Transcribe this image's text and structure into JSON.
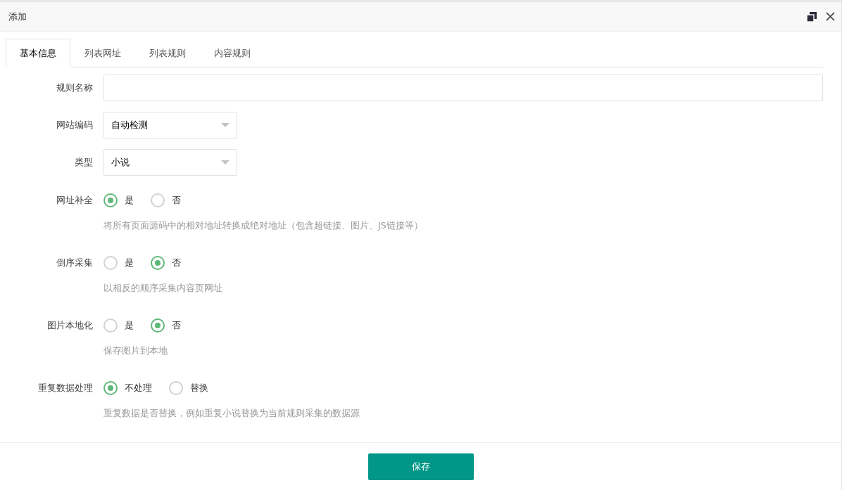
{
  "window": {
    "title": "添加"
  },
  "tabs": [
    {
      "label": "基本信息",
      "selected": true
    },
    {
      "label": "列表网址",
      "selected": false
    },
    {
      "label": "列表规则",
      "selected": false
    },
    {
      "label": "内容规则",
      "selected": false
    }
  ],
  "fields": [
    {
      "kind": "text",
      "label": "规则名称"
    },
    {
      "kind": "select",
      "label": "网站编码",
      "value": "自动检测"
    },
    {
      "kind": "select",
      "label": "类型",
      "value": "小说"
    },
    {
      "kind": "radio",
      "label": "网址补全",
      "options": [
        {
          "label": "是",
          "selected": true
        },
        {
          "label": "否",
          "selected": false
        }
      ],
      "hint": "将所有页面源码中的相对地址转换成绝对地址（包含超链接、图片、JS链接等）"
    },
    {
      "kind": "radio",
      "label": "倒序采集",
      "options": [
        {
          "label": "是",
          "selected": false
        },
        {
          "label": "否",
          "selected": true
        }
      ],
      "hint": "以相反的顺序采集内容页网址"
    },
    {
      "kind": "radio",
      "label": "图片本地化",
      "options": [
        {
          "label": "是",
          "selected": false
        },
        {
          "label": "否",
          "selected": true
        }
      ],
      "hint": "保存图片到本地"
    },
    {
      "kind": "radio",
      "label": "重复数据处理",
      "options": [
        {
          "label": "不处理",
          "selected": true
        },
        {
          "label": "替换",
          "selected": false
        }
      ],
      "hint": "重复数据是否替换，例如重复小说替换为当前规则采集的数据源"
    }
  ],
  "save_button": "保存"
}
